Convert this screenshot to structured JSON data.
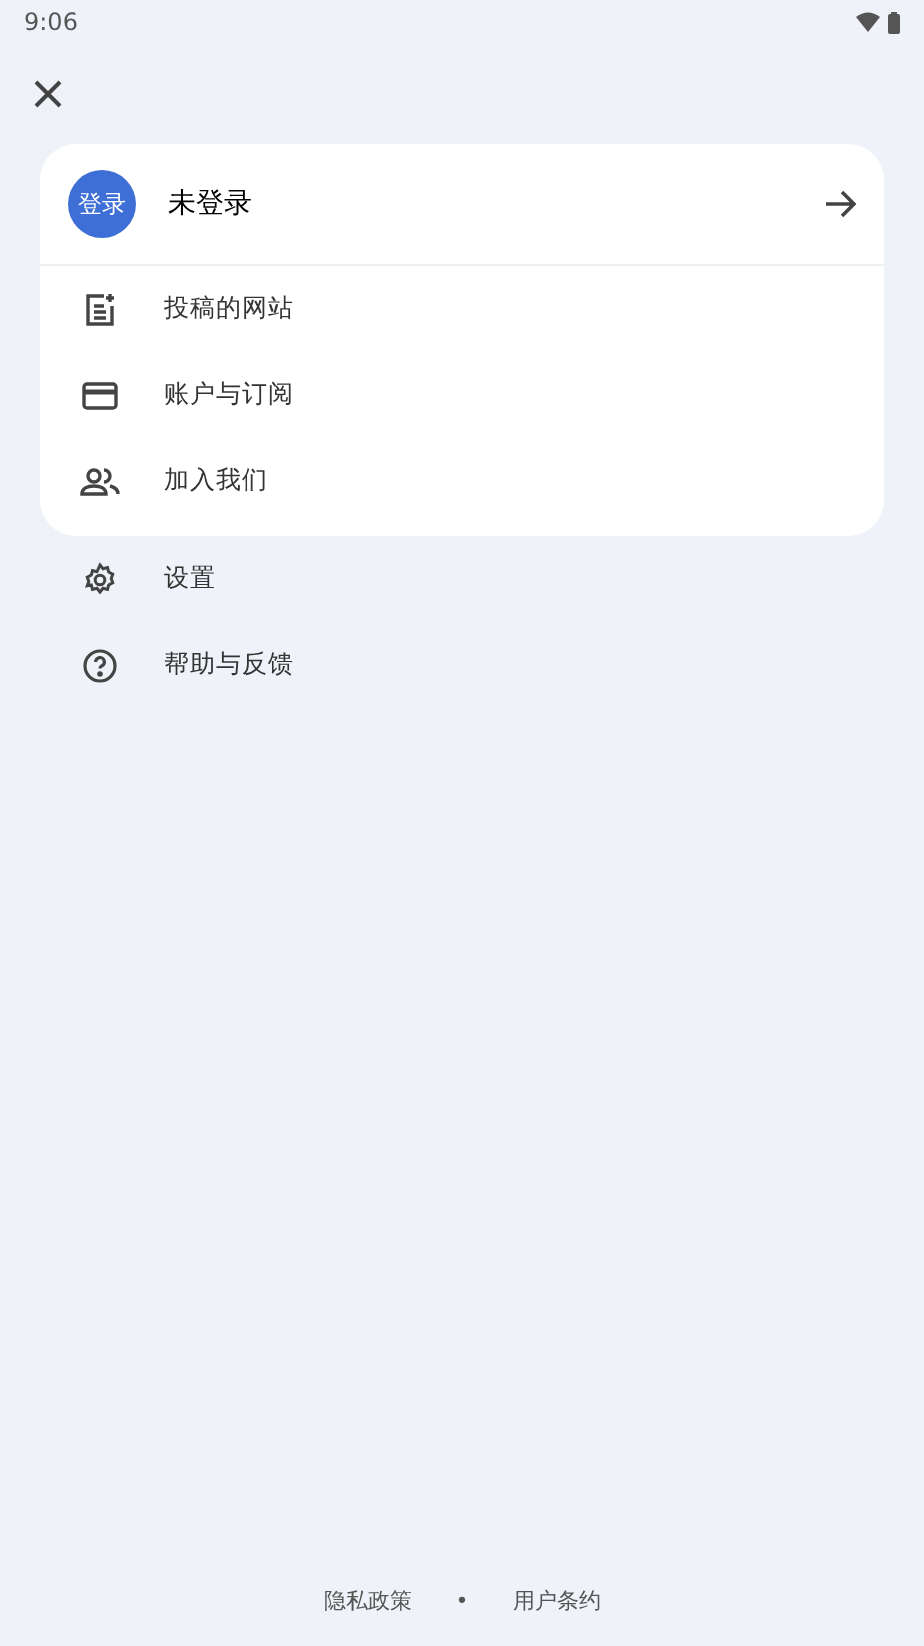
{
  "status_bar": {
    "time": "9:06"
  },
  "account_card": {
    "avatar": "登录",
    "title": "未登录",
    "items": [
      {
        "label": "投稿的网站"
      },
      {
        "label": "账户与订阅"
      },
      {
        "label": "加入我们"
      }
    ]
  },
  "menu_items": [
    {
      "label": "设置"
    },
    {
      "label": "帮助与反馈"
    }
  ],
  "footer": {
    "links": [
      "隐私政策",
      "用户条约"
    ],
    "separator": "•"
  }
}
